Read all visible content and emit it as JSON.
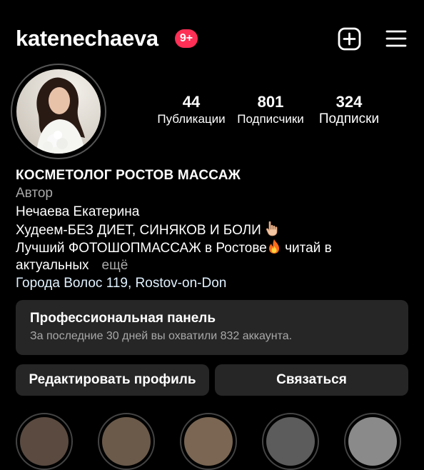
{
  "header": {
    "username": "katenechaeva",
    "notification_badge": "9+",
    "icons": [
      "add-post-icon",
      "menu-icon"
    ]
  },
  "profile": {
    "avatar_icon": "avatar-photo",
    "stats": [
      {
        "count": "44",
        "label": "Публикации"
      },
      {
        "count": "801",
        "label": "Подписчики"
      },
      {
        "count": "324",
        "label": "Подписки"
      }
    ]
  },
  "bio": {
    "title": "КОСМЕТОЛОГ РОСТОВ МАССАЖ",
    "category": "Автор",
    "name": "Нечаева Екатерина",
    "line1": "Худеем-БЕЗ ДИЕТ, СИНЯКОВ И БОЛИ",
    "line1_emoji": "pointing-down-hand-icon",
    "line2_part1": "Лучший ФОТОШОПМАССАЖ в Ростове",
    "line2_emoji": "fire-icon",
    "line2_part2": "читай в",
    "line3": "актуальных",
    "more": "ещё",
    "location": "Города Волос 119, Rostov-on-Don"
  },
  "professional_panel": {
    "title": "Профессиональная панель",
    "subtitle": "За последние 30 дней вы охватили 832 аккаунта."
  },
  "actions": {
    "edit_profile": "Редактировать профиль",
    "contact": "Связаться"
  },
  "colors": {
    "background": "#000000",
    "surface": "#262626",
    "badge": "#ff2f55",
    "muted_text": "#a8a8a8"
  }
}
